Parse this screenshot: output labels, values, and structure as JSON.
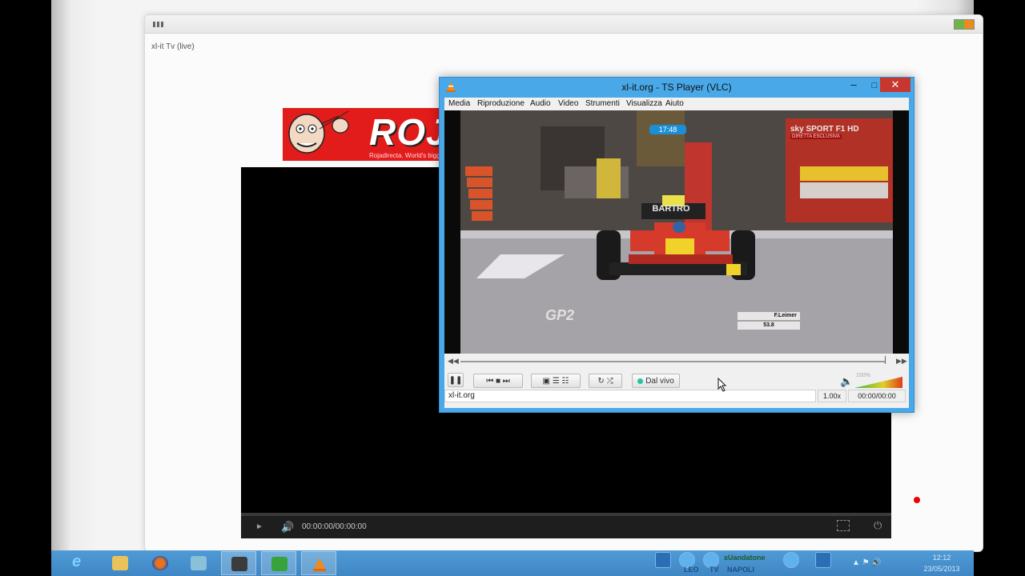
{
  "browser": {
    "page_title": "xl-it Tv (live)"
  },
  "banner": {
    "logo_text": "ROJA",
    "tagline": "Rojadirecta. World's biggest sports stream"
  },
  "embedded_player": {
    "time": "00:00:00/00:00:00"
  },
  "vlc": {
    "title": "xl-it.org - TS Player (VLC)",
    "menu": [
      "Media",
      "Riproduzione",
      "Audio",
      "Video",
      "Strumenti",
      "Visualizza",
      "Aiuto"
    ],
    "video_osd": {
      "clock": "17:48",
      "channel": "sky SPORT F1 HD",
      "channel_sub": "DIRETTA ESCLUSIVA",
      "car_sign": "BARTRO",
      "driver": "F.Leimer",
      "gap": "53.8",
      "series_logo": "GP2"
    },
    "live_label": "Dal vivo",
    "volume_percent": "100%",
    "volume_level": 1.0,
    "status_text": "xl-it.org",
    "speed": "1.00x",
    "time": "00:00/00:00"
  },
  "taskbar": {
    "apps": [
      "internet-explorer",
      "file-explorer",
      "firefox",
      "app-1",
      "app-2",
      "app-3",
      "vlc"
    ],
    "tray_labels": [
      "LEO",
      "TV",
      "sUandatone",
      "NAPOLI"
    ],
    "clock_time": "12:12",
    "clock_date": "23/05/2013"
  },
  "colors": {
    "vlc_frame": "#49a8e8",
    "taskbar": "#4f9bd6",
    "roja_red": "#e21b1b",
    "close_red": "#c7372f",
    "live_dot": "#26c3a2"
  }
}
